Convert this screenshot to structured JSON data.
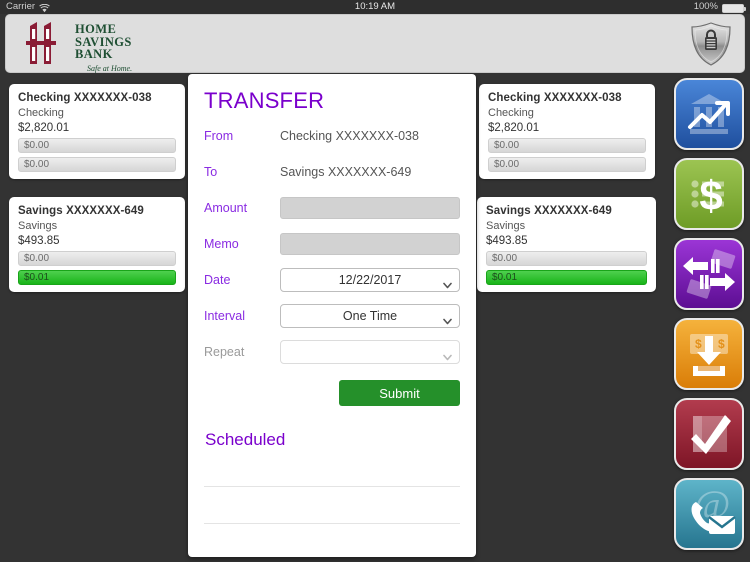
{
  "status_bar": {
    "carrier": "Carrier",
    "wifi_icon": "wifi-icon",
    "time": "10:19 AM",
    "battery_percent": "100%",
    "battery_icon": "battery-full-icon"
  },
  "header": {
    "logo_line1": "HOME",
    "logo_line2": "SAVINGS",
    "logo_line3": "BANK",
    "tagline": "Safe at Home.",
    "logo_mark_icon": "home-columns-logo-icon",
    "security_button_icon": "shield-lock-icon"
  },
  "colors": {
    "accent_purple": "#7a00cc",
    "label_purple": "#8a2be2",
    "submit_green": "#25902a",
    "bar_green": "#19b419",
    "logo_green": "#1f4f33",
    "logo_maroon": "#8a1c35",
    "page_background": "#333333",
    "header_background": "#dedede"
  },
  "left_accounts": [
    {
      "title": "Checking XXXXXXX-038",
      "type": "Checking",
      "balance": "$2,820.01",
      "bars": [
        {
          "value": "$0.00",
          "highlight": false
        },
        {
          "value": "$0.00",
          "highlight": false
        }
      ]
    },
    {
      "title": "Savings XXXXXXX-649",
      "type": "Savings",
      "balance": "$493.85",
      "bars": [
        {
          "value": "$0.00",
          "highlight": false
        },
        {
          "value": "$0.01",
          "highlight": true
        }
      ]
    }
  ],
  "right_accounts": [
    {
      "title": "Checking XXXXXXX-038",
      "type": "Checking",
      "balance": "$2,820.01",
      "bars": [
        {
          "value": "$0.00",
          "highlight": false
        },
        {
          "value": "$0.00",
          "highlight": false
        }
      ]
    },
    {
      "title": "Savings XXXXXXX-649",
      "type": "Savings",
      "balance": "$493.85",
      "bars": [
        {
          "value": "$0.00",
          "highlight": false
        },
        {
          "value": "$0.01",
          "highlight": true
        }
      ]
    }
  ],
  "transfer": {
    "title": "TRANSFER",
    "from_label": "From",
    "from_value": "Checking XXXXXXX-038",
    "to_label": "To",
    "to_value": "Savings XXXXXXX-649",
    "amount_label": "Amount",
    "amount_value": "",
    "memo_label": "Memo",
    "memo_value": "",
    "date_label": "Date",
    "date_value": "12/22/2017",
    "interval_label": "Interval",
    "interval_value": "One Time",
    "repeat_label": "Repeat",
    "repeat_value": "",
    "submit_label": "Submit",
    "scheduled_title": "Scheduled",
    "scheduled_items": []
  },
  "rail": [
    {
      "name": "accounts-button",
      "icon": "bank-chart-icon",
      "color": "#2f6fc4"
    },
    {
      "name": "payments-button",
      "icon": "dollar-list-icon",
      "color": "#7aad33"
    },
    {
      "name": "transfers-button",
      "icon": "transfer-arrows-icon",
      "color": "#7a21b5"
    },
    {
      "name": "deposit-button",
      "icon": "deposit-money-icon",
      "color": "#e89417"
    },
    {
      "name": "approvals-button",
      "icon": "checkmark-box-icon",
      "color": "#9b2435"
    },
    {
      "name": "contact-button",
      "icon": "phone-email-icon",
      "color": "#3d93ab"
    }
  ]
}
